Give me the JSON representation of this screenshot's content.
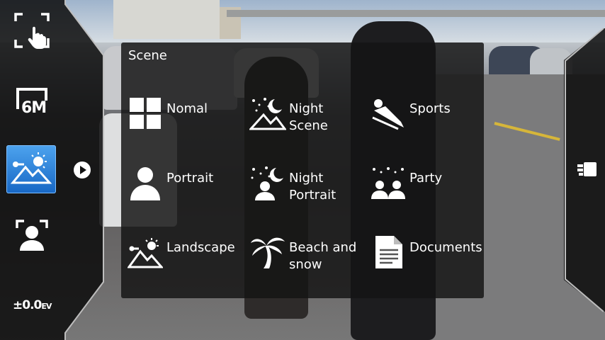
{
  "left_panel": {
    "touch_focus_icon": "touch-focus-icon",
    "resolution_label": "6M",
    "ev_value": "±0.0",
    "ev_unit": "EV"
  },
  "scene_menu": {
    "title": "Scene",
    "items": [
      {
        "label": "Nomal",
        "icon": "grid-icon"
      },
      {
        "label": "Night\nScene",
        "icon": "night-scene-icon"
      },
      {
        "label": "Sports",
        "icon": "sports-icon"
      },
      {
        "label": "Portrait",
        "icon": "portrait-icon"
      },
      {
        "label": "Night\nPortrait",
        "icon": "night-portrait-icon"
      },
      {
        "label": "Party",
        "icon": "party-icon"
      },
      {
        "label": "Landscape",
        "icon": "landscape-icon"
      },
      {
        "label": "Beach and\nsnow",
        "icon": "palm-tree-icon"
      },
      {
        "label": "Documents",
        "icon": "document-icon"
      }
    ]
  },
  "colors": {
    "selected_accent": "#2f86de",
    "panel_bg": "#141414"
  }
}
